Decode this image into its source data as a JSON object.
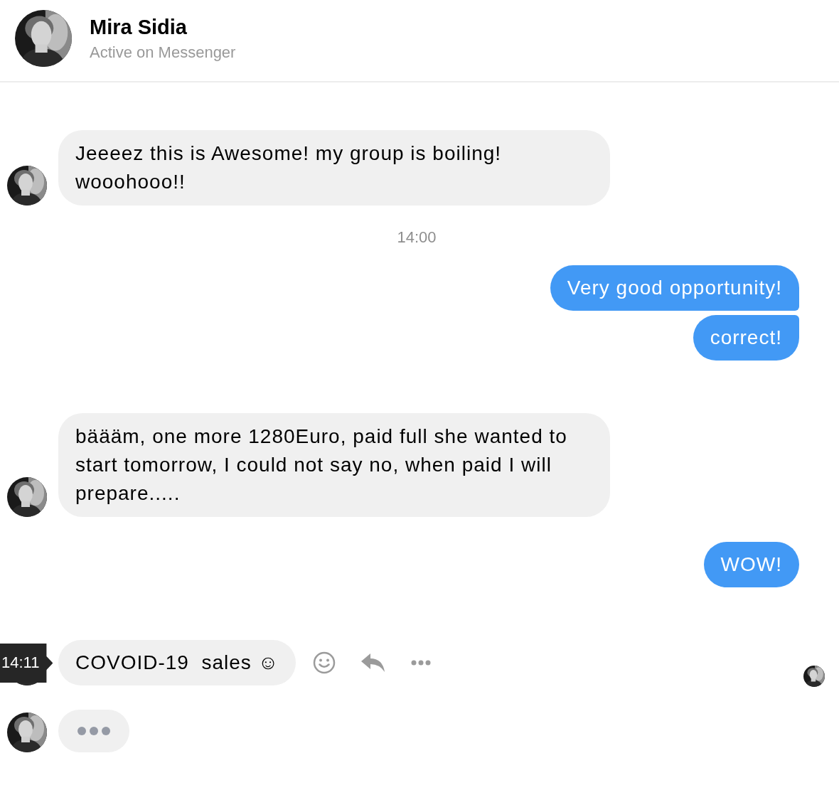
{
  "header": {
    "name": "Mira Sidia",
    "status": "Active on Messenger"
  },
  "messages": [
    {
      "kind": "received",
      "text": "Jeeeez this is Awesome! my group is boiling! wooohooo!!",
      "avatar": true
    },
    {
      "kind": "time",
      "text": "14:00"
    },
    {
      "kind": "sent",
      "text": "Very good opportunity!"
    },
    {
      "kind": "sent",
      "text": "correct!"
    },
    {
      "kind": "received",
      "text": "bäääm, one more 1280Euro, paid full she wanted to start tomorrow, I could not say no, when paid I will prepare.....",
      "avatar": true
    },
    {
      "kind": "sent",
      "text": "WOW!"
    },
    {
      "kind": "received",
      "text": "COVOID-19  sales ☺",
      "avatar": true,
      "tooltip": "14:11",
      "actions": true,
      "seen": true
    },
    {
      "kind": "typing",
      "avatar": true
    }
  ]
}
